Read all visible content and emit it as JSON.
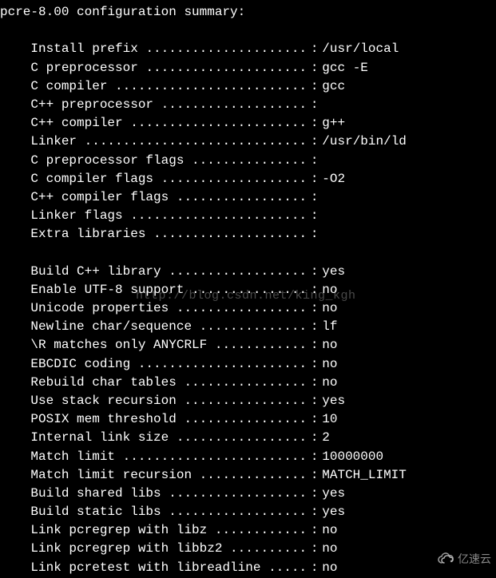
{
  "header": "pcre-8.00 configuration summary:",
  "watermark": "http://blog.csdn.net/king_kgh",
  "logo_text": "亿速云",
  "label_width_ch": 36,
  "rows_block1": [
    {
      "label": "Install prefix",
      "value": "/usr/local"
    },
    {
      "label": "C preprocessor",
      "value": "gcc -E"
    },
    {
      "label": "C compiler",
      "value": "gcc"
    },
    {
      "label": "C++ preprocessor",
      "value": ""
    },
    {
      "label": "C++ compiler",
      "value": "g++"
    },
    {
      "label": "Linker",
      "value": "/usr/bin/ld"
    },
    {
      "label": "C preprocessor flags",
      "value": ""
    },
    {
      "label": "C compiler flags",
      "value": "-O2"
    },
    {
      "label": "C++ compiler flags",
      "value": ""
    },
    {
      "label": "Linker flags",
      "value": ""
    },
    {
      "label": "Extra libraries",
      "value": ""
    }
  ],
  "rows_block2": [
    {
      "label": "Build C++ library",
      "value": "yes"
    },
    {
      "label": "Enable UTF-8 support",
      "value": "no"
    },
    {
      "label": "Unicode properties",
      "value": "no"
    },
    {
      "label": "Newline char/sequence",
      "value": "lf"
    },
    {
      "label": "\\R matches only ANYCRLF",
      "value": "no"
    },
    {
      "label": "EBCDIC coding",
      "value": "no"
    },
    {
      "label": "Rebuild char tables",
      "value": "no"
    },
    {
      "label": "Use stack recursion",
      "value": "yes"
    },
    {
      "label": "POSIX mem threshold",
      "value": "10"
    },
    {
      "label": "Internal link size",
      "value": "2"
    },
    {
      "label": "Match limit",
      "value": "10000000"
    },
    {
      "label": "Match limit recursion",
      "value": "MATCH_LIMIT"
    },
    {
      "label": "Build shared libs",
      "value": "yes"
    },
    {
      "label": "Build static libs",
      "value": "yes"
    },
    {
      "label": "Link pcregrep with libz",
      "value": "no"
    },
    {
      "label": "Link pcregrep with libbz2",
      "value": "no"
    },
    {
      "label": "Link pcretest with libreadline",
      "value": "no"
    }
  ]
}
